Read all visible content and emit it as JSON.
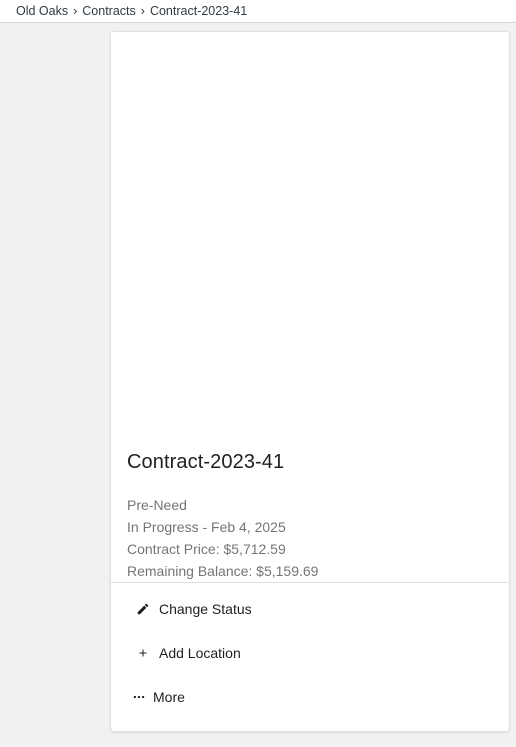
{
  "breadcrumb": {
    "items": [
      "Old Oaks",
      "Contracts",
      "Contract-2023-41"
    ],
    "separator": "›"
  },
  "card": {
    "title": "Contract-2023-41",
    "details": [
      "Pre-Need",
      "In Progress - Feb 4, 2025",
      "Contract Price: $5,712.59",
      "Remaining Balance: $5,159.69"
    ],
    "actions": [
      {
        "label": "Change Status",
        "icon": "pencil-icon"
      },
      {
        "label": "Add Location",
        "icon": "plus-icon"
      },
      {
        "label": "More",
        "icon": "more-dots-icon"
      }
    ]
  }
}
